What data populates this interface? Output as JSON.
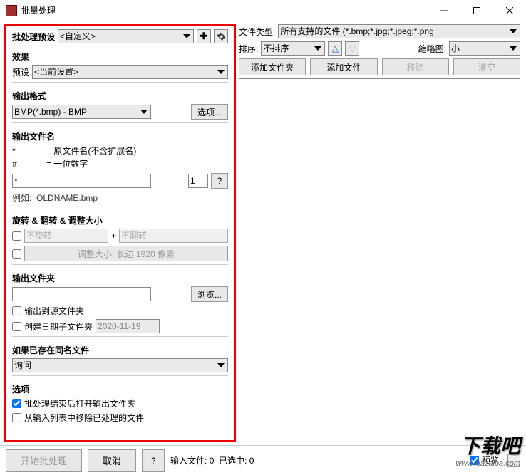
{
  "window": {
    "title": "批量处理"
  },
  "titlebar_buttons": [
    "min",
    "max",
    "close"
  ],
  "left": {
    "preset_label": "批处理预设",
    "preset_value": "<自定义>",
    "effect_header": "效果",
    "effect_preset_label": "预设",
    "effect_preset_value": "<当前设置>",
    "output_format_header": "输出格式",
    "output_format_value": "BMP(*.bmp) - BMP",
    "options_btn": "选项...",
    "filename_header": "输出文件名",
    "filename_desc_star_key": "*",
    "filename_desc_star_val": "= 原文件名(不含扩展名)",
    "filename_desc_hash_key": "#",
    "filename_desc_hash_val": "= 一位数字",
    "filename_pattern": "*",
    "filename_number": "1",
    "filename_help": "?",
    "filename_example_label": "例如:",
    "filename_example_value": "OLDNAME.bmp",
    "rotate_header": "旋转 & 翻转 & 调整大小",
    "rotate_value": "不旋转",
    "plus": "+",
    "flip_value": "不翻转",
    "resize_text": "调整大小: 长边 1920 像素",
    "outdir_header": "输出文件夹",
    "browse_btn": "浏览...",
    "outdir_source_chk": "输出到源文件夹",
    "outdir_date_chk": "创建日期子文件夹",
    "outdir_date_value": "2020-11-19",
    "exists_header": "如果已存在同名文件",
    "exists_value": "询问",
    "opts_header": "选项",
    "opts_open_chk": "批处理结束后打开输出文件夹",
    "opts_remove_chk": "从输入列表中移除已处理的文件"
  },
  "right": {
    "filetype_label": "文件类型:",
    "filetype_value": "所有支持的文件 (*.bmp;*.jpg;*.jpeg;*.png",
    "sort_label": "排序:",
    "sort_value": "不排序",
    "thumb_label": "缩略图:",
    "thumb_value": "小",
    "btn_add_folder": "添加文件夹",
    "btn_add_file": "添加文件",
    "btn_remove": "移除",
    "btn_clear": "清空"
  },
  "bottom": {
    "start_btn": "开始批处理",
    "cancel_btn": "取消",
    "help_btn": "?",
    "status_input": "输入文件: 0",
    "status_selected": "已选中: 0",
    "preview_chk": "预览"
  },
  "watermark": {
    "big": "下载吧",
    "small": "www.xiazaiba.com"
  }
}
